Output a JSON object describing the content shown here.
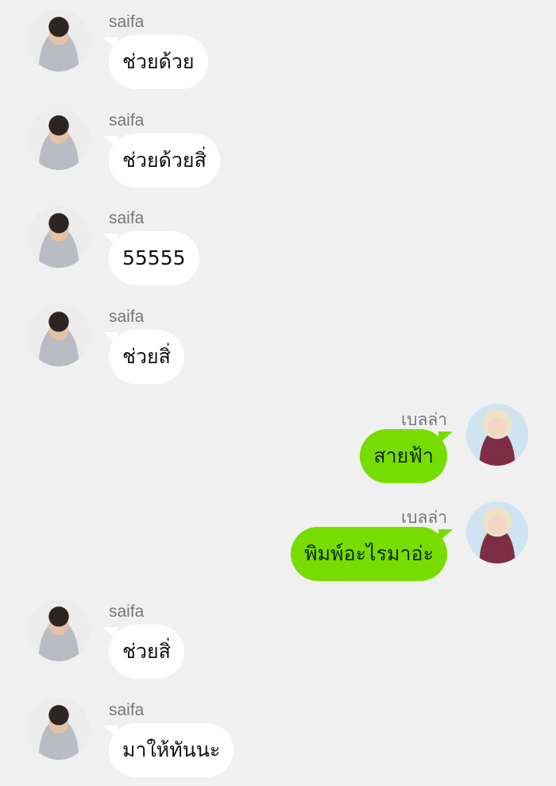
{
  "messages": [
    {
      "direction": "in",
      "sender": "saifa",
      "text": "ช่วยด้วย"
    },
    {
      "direction": "in",
      "sender": "saifa",
      "text": "ช่วยด้วยสิ่"
    },
    {
      "direction": "in",
      "sender": "saifa",
      "text": "55555"
    },
    {
      "direction": "in",
      "sender": "saifa",
      "text": "ช่วยสิ่"
    },
    {
      "direction": "out",
      "sender": "เบลล่า",
      "text": "สายฟ้า"
    },
    {
      "direction": "out",
      "sender": "เบลล่า",
      "text": "พิมพ์อะไรมาอ่ะ"
    },
    {
      "direction": "in",
      "sender": "saifa",
      "text": "ช่วยสิ่"
    },
    {
      "direction": "in",
      "sender": "saifa",
      "text": "มาให้ทันนะ"
    }
  ]
}
